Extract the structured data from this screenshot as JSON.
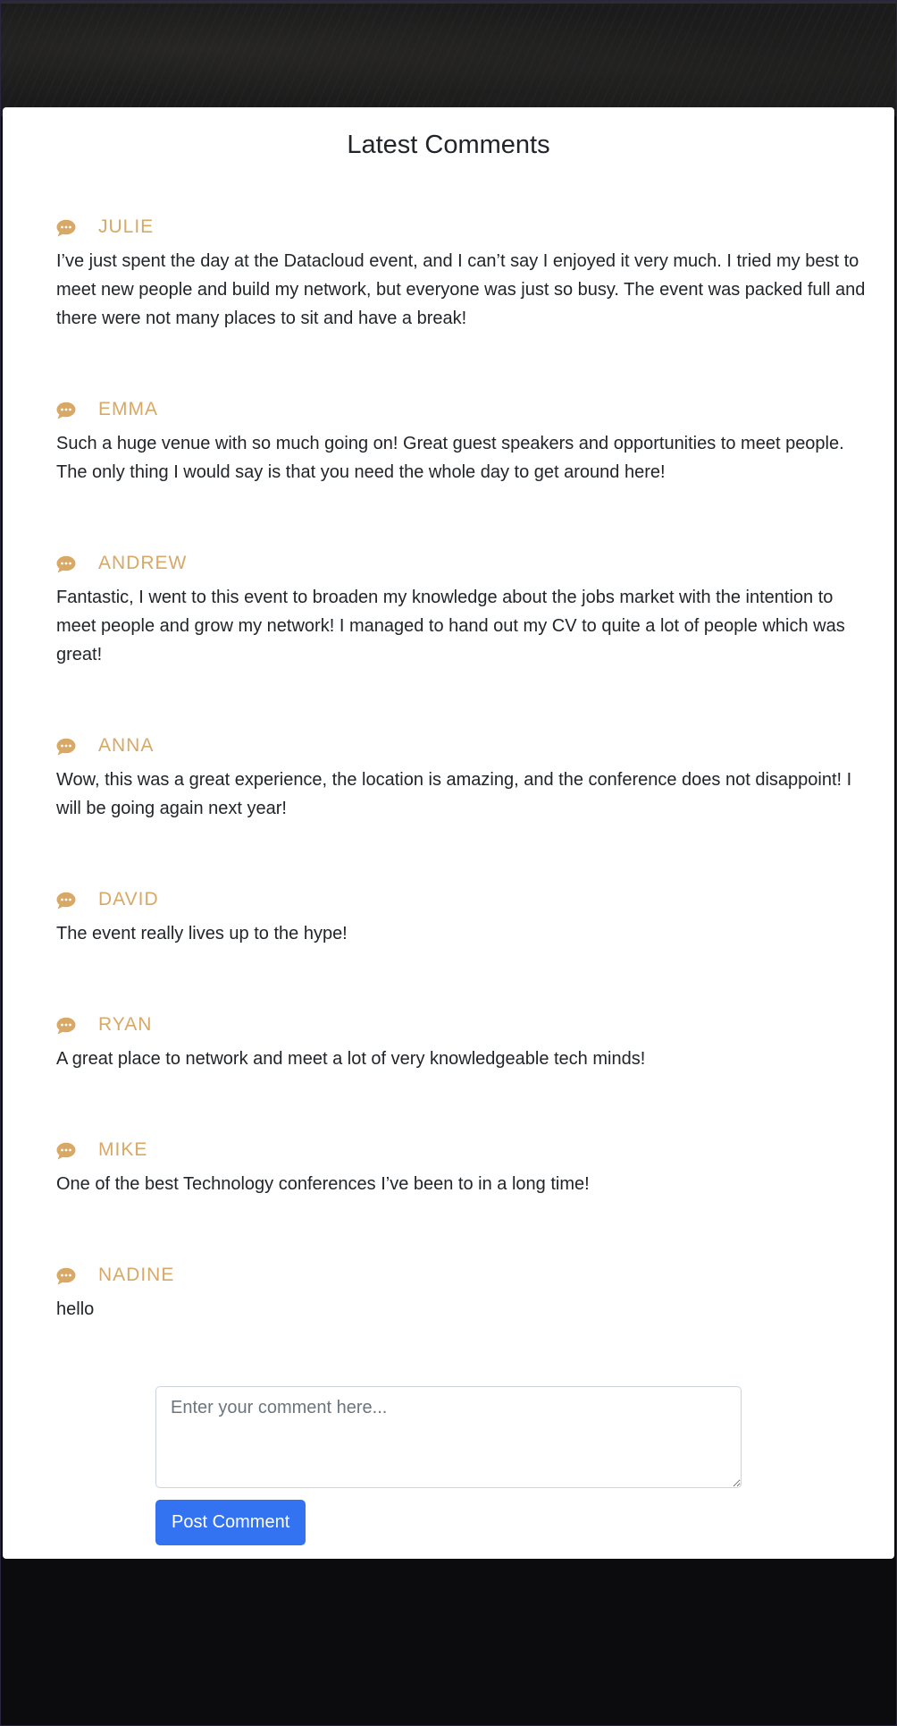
{
  "section": {
    "title": "Latest Comments"
  },
  "colors": {
    "accent": "#d7a866",
    "button": "#3372f0",
    "page_background": "#0c0c0e",
    "panel_background": "#ffffff"
  },
  "comments": [
    {
      "icon": "speech-bubble-icon",
      "author": "JULIE",
      "text": "I’ve just spent the day at the Datacloud event, and I can’t say I enjoyed it very much. I tried my best to meet new people and build my network, but everyone was just so busy. The event was packed full and there were not many places to sit and have a break!"
    },
    {
      "icon": "speech-bubble-icon",
      "author": "EMMA",
      "text": "Such a huge venue with so much going on! Great guest speakers and opportunities to meet people. The only thing I would say is that you need the whole day to get around here!"
    },
    {
      "icon": "speech-bubble-icon",
      "author": "ANDREW",
      "text": "Fantastic, I went to this event to broaden my knowledge about the jobs market with the intention to meet people and grow my network! I managed to hand out my CV to quite a lot of people which was great!"
    },
    {
      "icon": "speech-bubble-icon",
      "author": "ANNA",
      "text": "Wow, this was a great experience, the location is amazing, and the conference does not disappoint! I will be going again next year!"
    },
    {
      "icon": "speech-bubble-icon",
      "author": "DAVID",
      "text": "The event really lives up to the hype!"
    },
    {
      "icon": "speech-bubble-icon",
      "author": "RYAN",
      "text": "A great place to network and meet a lot of very knowledgeable tech minds!"
    },
    {
      "icon": "speech-bubble-icon",
      "author": "MIKE",
      "text": "One of the best Technology conferences I’ve been to in a long time!"
    },
    {
      "icon": "speech-bubble-icon",
      "author": "NADINE",
      "text": "hello"
    }
  ],
  "form": {
    "placeholder": "Enter your comment here...",
    "value": "",
    "submit_label": "Post Comment"
  }
}
